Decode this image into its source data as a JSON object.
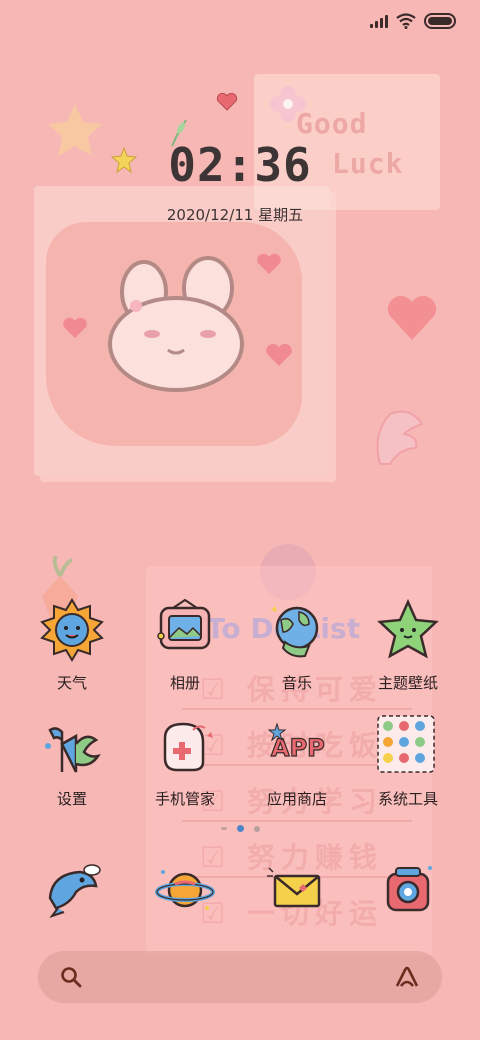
{
  "clock": {
    "time": "02:36",
    "date": "2020/12/11 星期五"
  },
  "wallpaper": {
    "good_luck": [
      "Good",
      "Luck"
    ],
    "todo_title": "To Do List",
    "todo_items": [
      "保持可爱",
      "按时吃饭",
      "努力学习",
      "努力赚钱",
      "一切好运"
    ]
  },
  "apps": [
    {
      "label": "天气",
      "icon": "sun-weather-icon"
    },
    {
      "label": "相册",
      "icon": "photo-frame-icon"
    },
    {
      "label": "音乐",
      "icon": "globe-music-icon"
    },
    {
      "label": "主题壁纸",
      "icon": "star-theme-icon"
    },
    {
      "label": "设置",
      "icon": "settings-plant-icon"
    },
    {
      "label": "手机管家",
      "icon": "phone-manager-icon"
    },
    {
      "label": "应用商店",
      "icon": "app-store-icon"
    },
    {
      "label": "系统工具",
      "icon": "system-tools-folder-icon"
    }
  ],
  "dock": [
    {
      "icon": "dolphin-icon"
    },
    {
      "icon": "planet-icon"
    },
    {
      "icon": "envelope-icon"
    },
    {
      "icon": "camera-icon"
    }
  ],
  "page_indicator": {
    "pages": 3,
    "current": 2
  },
  "colors": {
    "background": "#f6b7b5",
    "accent_blue": "#4a86c8"
  }
}
